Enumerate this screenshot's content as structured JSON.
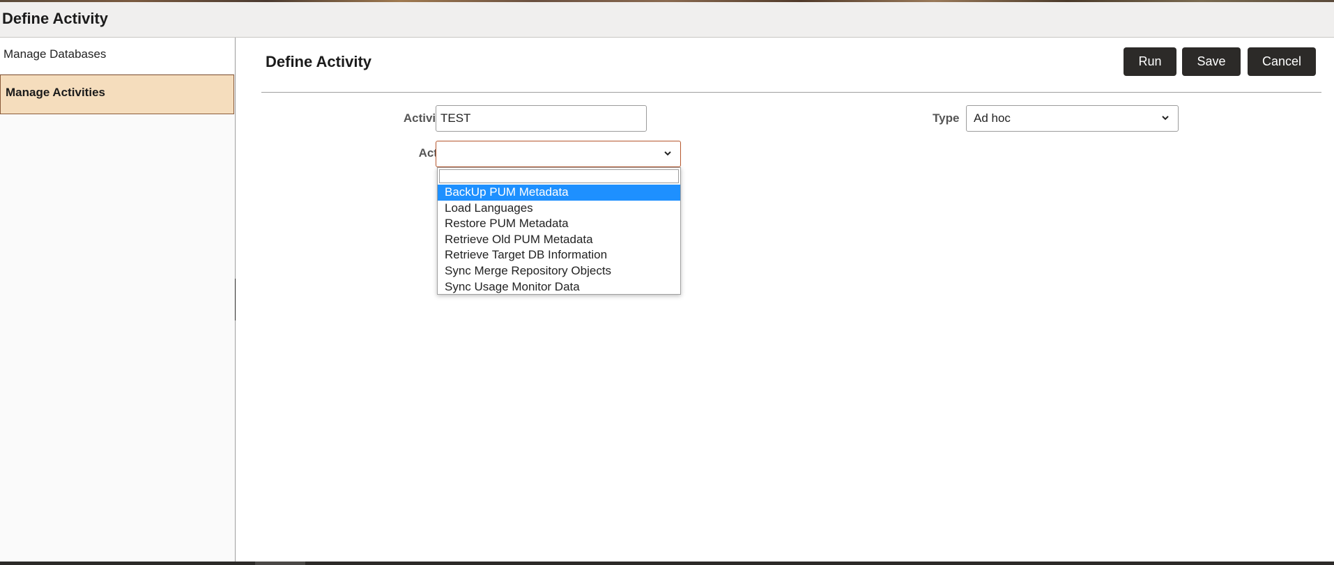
{
  "window": {
    "title": "Define Activity"
  },
  "sidebar": {
    "items": [
      {
        "label": "Manage Databases",
        "active": false
      },
      {
        "label": "Manage Activities",
        "active": true
      }
    ],
    "collapse_handle_glyph": "||"
  },
  "main": {
    "title": "Define Activity",
    "buttons": {
      "run": "Run",
      "save": "Save",
      "cancel": "Cancel"
    },
    "fields": {
      "activity_id": {
        "label": "Activity ID",
        "value": "TEST"
      },
      "type": {
        "label": "Type",
        "value": "Ad hoc"
      },
      "activity": {
        "label": "Activity",
        "value": ""
      }
    },
    "dropdown": {
      "search_value": "",
      "options": [
        {
          "label": "BackUp PUM Metadata",
          "highlighted": true
        },
        {
          "label": "Load Languages",
          "highlighted": false
        },
        {
          "label": "Restore PUM Metadata",
          "highlighted": false
        },
        {
          "label": "Retrieve Old PUM Metadata",
          "highlighted": false
        },
        {
          "label": "Retrieve Target DB Information",
          "highlighted": false
        },
        {
          "label": "Sync Merge Repository Objects",
          "highlighted": false
        },
        {
          "label": "Sync Usage Monitor Data",
          "highlighted": false
        }
      ]
    }
  },
  "colors": {
    "button_bg": "#2c2a28",
    "active_nav_bg": "#f5ddbd",
    "active_nav_border": "#8a5a3a",
    "focused_border": "#b5562c",
    "option_highlight": "#1e90ff"
  },
  "icons": {
    "select_chevron": "chevron-down-icon",
    "collapse": "collapse-handle-icon"
  }
}
